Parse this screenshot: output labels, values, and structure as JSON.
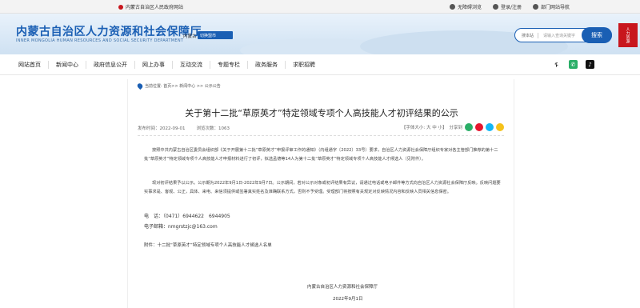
{
  "topbar": {
    "site_link": "内蒙古自治区人民政府网站",
    "accessibility": "无障碍浏览",
    "login": "登录/注册",
    "site_nav": "部门网站导航"
  },
  "header": {
    "title": "内蒙古自治区人力资源和社会保障厅",
    "subtitle": "INNER MONGOLIA HUMAN RESOURCES AND SOCIAL SECURITY DEPARTMENT",
    "city_label": "内蒙古",
    "city_select": "切换盟市",
    "search_scope": "搜本站",
    "search_placeholder": "请输入查询关键字",
    "search_button": "搜索",
    "emblem_text": "人力资源"
  },
  "nav": {
    "items": [
      "网站首页",
      "新闻中心",
      "政府信息公开",
      "网上办事",
      "互动交流",
      "专题专栏",
      "政务服务",
      "求职招聘"
    ]
  },
  "article": {
    "breadcrumb": "当前位置: 首页>> 新闻中心 >> 公示公告",
    "title": "关于第十二批“草原英才”特定领域专项个人高技能人才初评结果的公示",
    "publish_date": "发布时间：2022-09-01",
    "views": "浏览次数：1063",
    "font_size": "【字体大小: 大 中 小】",
    "share_label": "分享到",
    "para1": "按照中共内蒙古自治区委员会组织部《关于开展第十二批“草原英才”申报评审工作的通知》（内组通字〔2022〕33号）要求，自治区人力资源社会保障厅组织专家对各主管部门推荐的第十二批“草原英才”特定领域专项个人高技能人才申报材料进行了初评，拟选孟德等14人为第十二批“草原英才”特定领域专项个人高技能人才候选人（见附件）。",
    "para2": "现对初评结果予以公示。公示期为2022年9月1日-2022年9月7日。公示期间，若对公示对象或初评结果有异议，请通过电话或电子邮件等方式向自治区人力资源社会保障厅反映。反映问题要实事求是、客观、公正，具体、来电、来信须提供或签署真实姓名及准确联系方式，否则不予受理。受理部门将按照有关规定对反映情况内容和反映人员相关信息保密。",
    "phone": "电　话：（0471）6944622　6944905",
    "email": "电子邮箱：nmgrstzjc@163.com",
    "attachment": "附件：十二批“草原英才”特定领域专项个人高技能人才候选人名单",
    "signature": "内蒙古自治区人力资源和社会保障厅",
    "sign_date": "2022年9月1日"
  }
}
